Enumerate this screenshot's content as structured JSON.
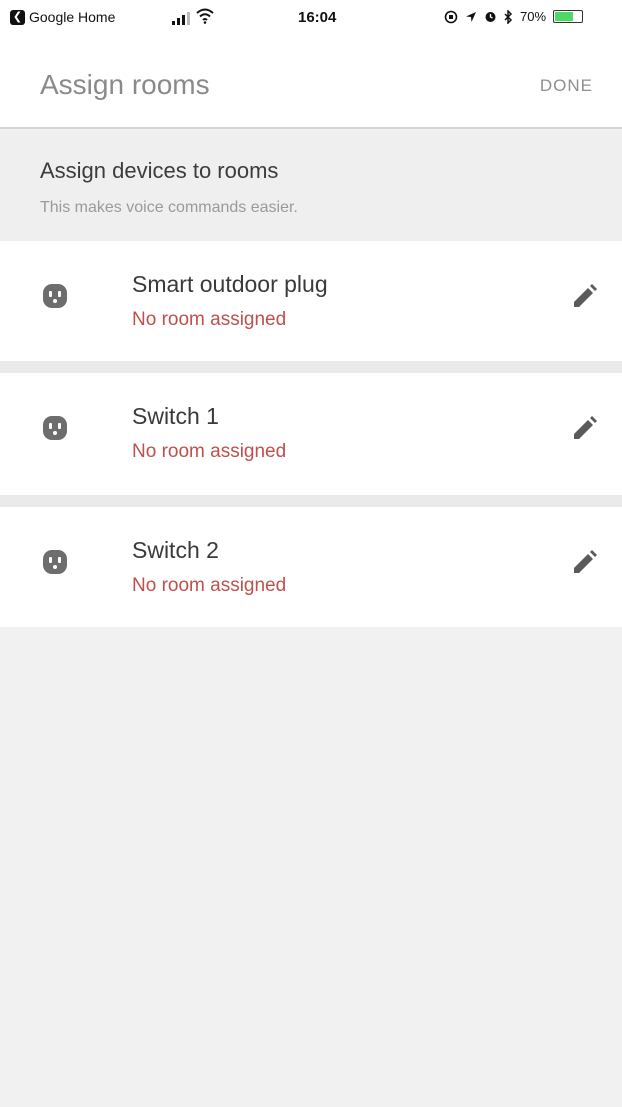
{
  "status_bar": {
    "back_app": "Google Home",
    "time": "16:04",
    "battery_percent": "70%",
    "battery_level": 0.7
  },
  "app_bar": {
    "title": "Assign rooms",
    "done_label": "DONE"
  },
  "section": {
    "heading": "Assign devices to rooms",
    "subheading": "This makes voice commands easier."
  },
  "devices": [
    {
      "name": "Smart outdoor plug",
      "room": "No room assigned",
      "icon": "outlet-icon"
    },
    {
      "name": "Switch 1",
      "room": "No room assigned",
      "icon": "outlet-icon"
    },
    {
      "name": "Switch 2",
      "room": "No room assigned",
      "icon": "outlet-icon"
    }
  ],
  "colors": {
    "unassigned": "#c0504d",
    "title": "#8a8a8a",
    "background": "#f1f1f1"
  }
}
